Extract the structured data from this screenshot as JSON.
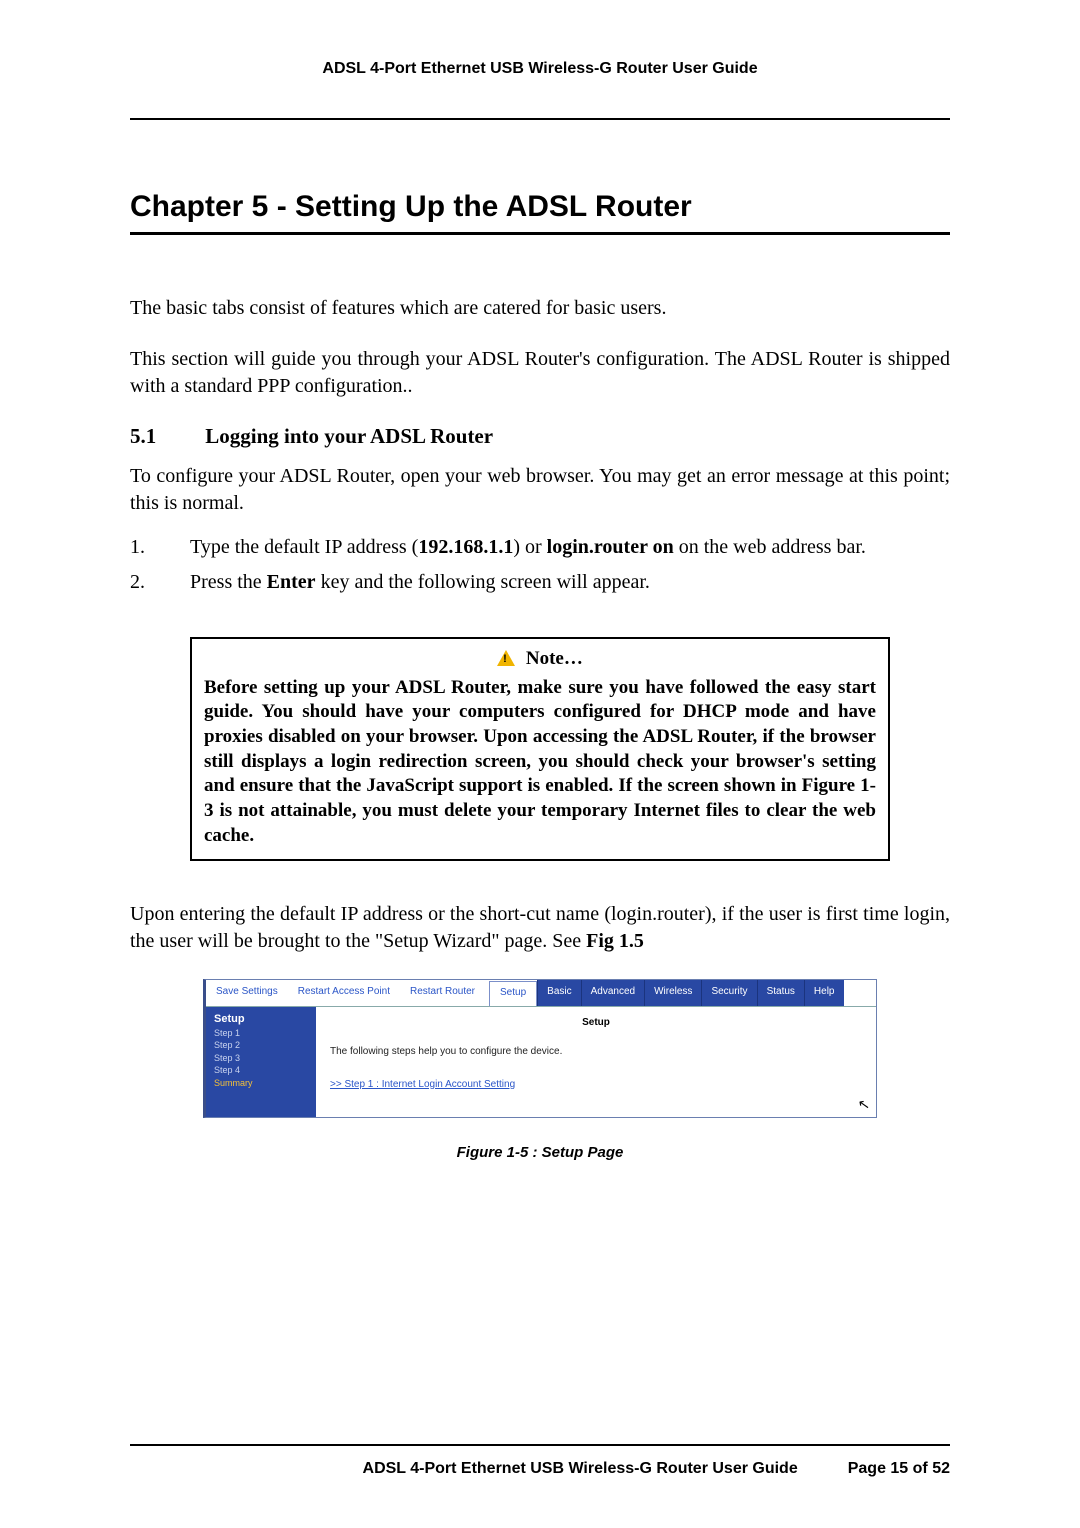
{
  "header": {
    "running_title": "ADSL 4-Port Ethernet USB Wireless-G Router User Guide"
  },
  "chapter": {
    "title": "Chapter 5  - Setting Up the ADSL Router",
    "intro1": "The basic tabs consist of features which are catered for basic users.",
    "intro2": "This section will guide you through your ADSL Router's configuration. The ADSL Router is shipped with a standard PPP configuration.."
  },
  "section": {
    "number": "5.1",
    "title": "Logging into your ADSL Router",
    "lead": "To configure your ADSL Router, open your web browser. You may get an error message at this point; this is normal.",
    "steps": {
      "s1_pre": "Type the default IP address (",
      "s1_ip": "192.168.1.1",
      "s1_mid": ") or ",
      "s1_login": "login.router on",
      "s1_post": " on the web address bar.",
      "s2_pre": "Press the ",
      "s2_key": "Enter",
      "s2_post": " key and the following screen will appear."
    }
  },
  "note": {
    "label": "Note…",
    "pre": "Before setting up your ADSL Router, make sure you have followed the ",
    "easy": "easy start guide.",
    "post": " You should have your computers configured for DHCP mode and have proxies disabled on your browser. Upon accessing the ADSL Router, if the browser still displays a login redirection screen, you should check your browser's setting and ensure that the JavaScript support is enabled. If the screen shown in Figure 1-3 is not attainable, you must delete your temporary Internet files to clear the web cache."
  },
  "after_note": {
    "pre": "Upon entering the default IP address or the short-cut name (login.router), if the user is first time login, the user will be brought to the \"Setup Wizard\" page. See ",
    "ref": "Fig 1.5"
  },
  "router_ui": {
    "top_links": {
      "save": "Save Settings",
      "restart_ap": "Restart Access Point",
      "restart_router": "Restart Router"
    },
    "tabs": {
      "active": "Setup",
      "items": [
        "Basic",
        "Advanced",
        "Wireless",
        "Security",
        "Status",
        "Help"
      ]
    },
    "sidebar": {
      "title": "Setup",
      "items": [
        "Step 1",
        "Step 2",
        "Step 3",
        "Step 4",
        "Summary"
      ]
    },
    "panel": {
      "title": "Setup",
      "text": "The following steps help you to configure the device.",
      "link": ">> Step 1 : Internet Login Account Setting"
    }
  },
  "figure": {
    "caption": "Figure 1-5 : Setup Page"
  },
  "footer": {
    "title": "ADSL 4-Port Ethernet USB Wireless-G Router User Guide",
    "page": "Page 15 of 52"
  }
}
